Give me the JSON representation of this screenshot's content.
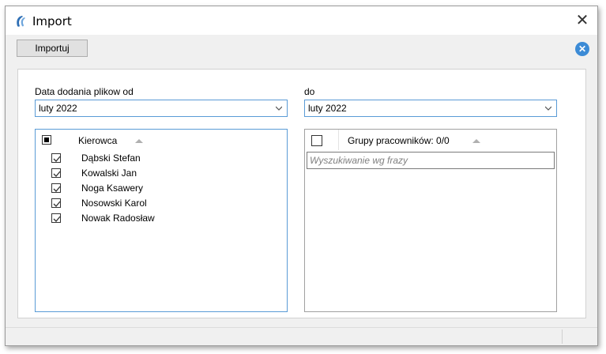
{
  "window": {
    "title": "Import"
  },
  "toolbar": {
    "import_label": "Importuj"
  },
  "filters": {
    "from_label": "Data dodania plikow od",
    "from_value": "luty 2022",
    "to_label": "do",
    "to_value": "luty 2022"
  },
  "drivers": {
    "header": "Kierowca",
    "items": [
      {
        "name": "Dąbski Stefan",
        "checked": true
      },
      {
        "name": "Kowalski Jan",
        "checked": true
      },
      {
        "name": "Noga Ksawery",
        "checked": true
      },
      {
        "name": "Nosowski Karol",
        "checked": true
      },
      {
        "name": "Nowak Radosław",
        "checked": true
      }
    ]
  },
  "groups": {
    "header": "Grupy pracowników: 0/0",
    "search_placeholder": "Wyszukiwanie wg frazy"
  },
  "colors": {
    "accent": "#5a9bd6",
    "close_button": "#3c8bd6"
  }
}
